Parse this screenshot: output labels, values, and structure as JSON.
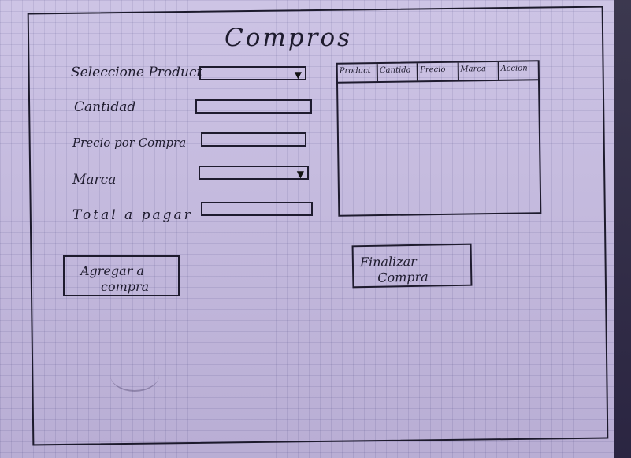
{
  "window": {
    "title": "Compros"
  },
  "form": {
    "producto_label": "Seleccione Product",
    "cantidad_label": "Cantidad",
    "precio_label": "Precio por Compra",
    "marca_label": "Marca",
    "total_label": "Total a pagar"
  },
  "table": {
    "columns": [
      "Product",
      "Cantida",
      "Precio",
      "Marca",
      "Accion"
    ]
  },
  "buttons": {
    "agregar_line1": "Agregar a",
    "agregar_line2": "compra",
    "finalizar_line1": "Finalizar",
    "finalizar_line2": "Compra"
  },
  "icons": {
    "dropdown": "chevron-down-icon"
  },
  "colors": {
    "paper": "#c9bfe3",
    "ink": "#1e1b2e"
  }
}
